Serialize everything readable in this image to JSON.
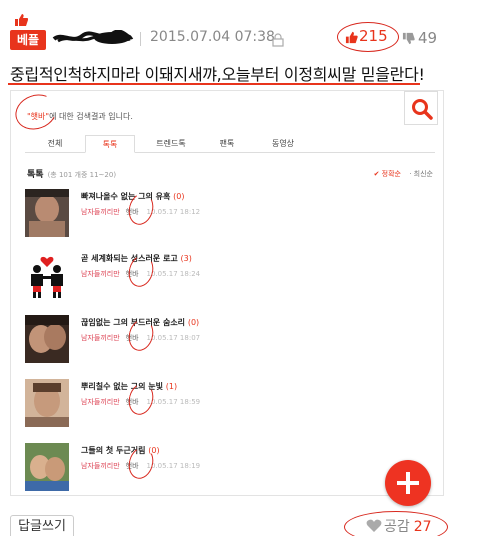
{
  "header": {
    "badge": "베플",
    "date": "2015.07.04 07:38",
    "upvotes": "215",
    "downvotes": "49"
  },
  "post": {
    "title": "중립적인척하지마라 이돼지새꺄,오늘부터 이정희씨말 믿을란다!"
  },
  "embedded": {
    "search_query": "\"햇바\"",
    "search_suffix": "에 대한 검색결과 입니다.",
    "tabs": [
      "전체",
      "톡톡",
      "트렌드톡",
      "팬톡",
      "동영상"
    ],
    "active_tab": "톡톡",
    "section_title": "톡톡",
    "section_count": "(총 101 개중 11~20)",
    "sort_options": [
      "✔ 정확순",
      "· 최신순"
    ],
    "items": [
      {
        "title": "빠져나올수 없는 그의 유혹",
        "count": "(0)",
        "category": "남자들끼리만",
        "channel": "햇바",
        "date": "10.05.17 18:12"
      },
      {
        "title": "곧 세계화되는 성스러운 로고",
        "count": "(3)",
        "category": "남자들끼리만",
        "channel": "햇바",
        "date": "10.05.17 18:24"
      },
      {
        "title": "끊임없는 그의 부드러운 숨소리",
        "count": "(0)",
        "category": "남자들끼리만",
        "channel": "햇바",
        "date": "10.05.17 18:07"
      },
      {
        "title": "뿌리칠수 없는 그의 눈빛",
        "count": "(1)",
        "category": "남자들끼리만",
        "channel": "햇바",
        "date": "10.05.17 18:59"
      },
      {
        "title": "그들의 첫 두근거림",
        "count": "(0)",
        "category": "남자들끼리만",
        "channel": "햇바",
        "date": "10.05.17 18:19"
      }
    ]
  },
  "footer": {
    "reply_label": "답글쓰기",
    "empathy_label": "공감",
    "empathy_count": "27"
  },
  "colors": {
    "accent": "#e8341c",
    "annotation": "#d8281e"
  }
}
